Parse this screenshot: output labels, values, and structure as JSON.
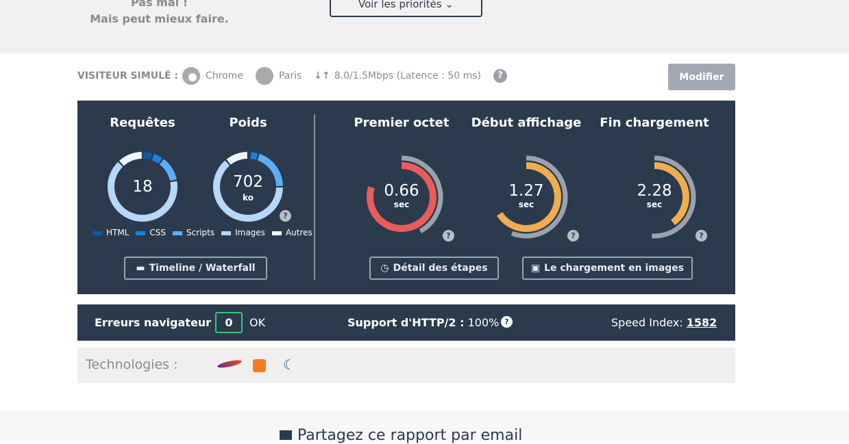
{
  "header": {
    "verdict_line1": "Pas mal !",
    "verdict_line2": "Mais peut mieux faire.",
    "priorities_button": "Voir les priorités"
  },
  "visitor": {
    "label": "VISITEUR SIMULÉ :",
    "browser": "Chrome",
    "location": "Paris",
    "connection": "8.0/1.5Mbps (Latence : 50 ms)",
    "help": "?",
    "modify_button": "Modifier"
  },
  "metrics": {
    "requests": {
      "title": "Requêtes",
      "value": "18",
      "fractions": [
        0.05,
        0.05,
        0.12,
        0.66,
        0.12
      ]
    },
    "weight": {
      "title": "Poids",
      "value": "702",
      "unit": "ko",
      "fractions": [
        0.01,
        0.04,
        0.2,
        0.64,
        0.11
      ]
    },
    "legend": [
      {
        "label": "HTML",
        "color": "#0d5aa7"
      },
      {
        "label": "CSS",
        "color": "#1a7fe0"
      },
      {
        "label": "Scripts",
        "color": "#5aaef5"
      },
      {
        "label": "Images",
        "color": "#b5d8fb"
      },
      {
        "label": "Autres",
        "color": "#eef5fd"
      }
    ],
    "timings": [
      {
        "title": "Premier octet",
        "value": "0.66",
        "unit": "sec",
        "color": "#e85c5c",
        "fill": 0.8,
        "reference": 0.42
      },
      {
        "title": "Début affichage",
        "value": "1.27",
        "unit": "sec",
        "color": "#f0ad4e",
        "fill": 0.66,
        "reference": 0.56
      },
      {
        "title": "Fin chargement",
        "value": "2.28",
        "unit": "sec",
        "color": "#f0ad4e",
        "fill": 0.4,
        "reference": 0.51
      }
    ],
    "buttons": {
      "timeline": "Timeline / Waterfall",
      "steps": "Détail des étapes",
      "images": "Le chargement en images"
    }
  },
  "status": {
    "errors_label": "Erreurs navigateur",
    "errors_count": "0",
    "errors_status": "OK",
    "http2_label": "Support d'HTTP/2 :",
    "http2_value": "100%",
    "speed_index_label": "Speed Index:",
    "speed_index_value": "1582"
  },
  "technologies": {
    "label": "Technologies :",
    "items": [
      "apache",
      "google-analytics",
      "jquery"
    ]
  },
  "share": {
    "title": "Partagez ce rapport par email"
  }
}
